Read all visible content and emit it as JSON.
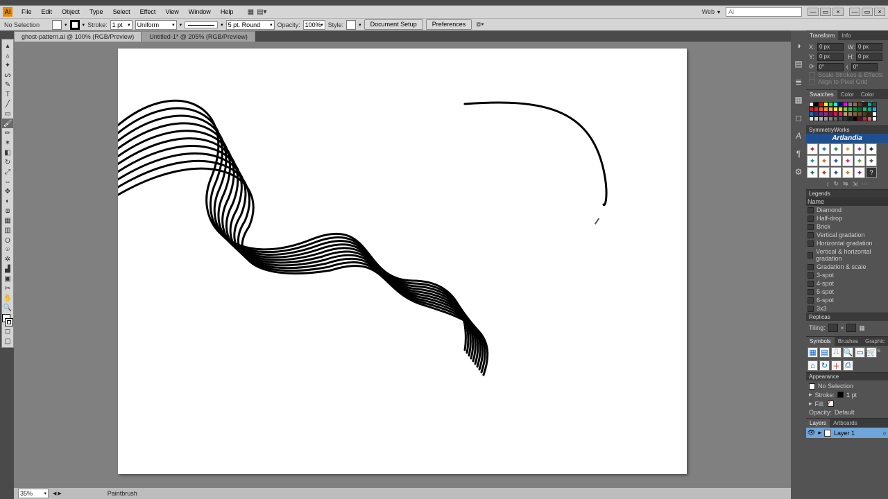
{
  "app": {
    "badge": "Ai"
  },
  "menu": [
    "File",
    "Edit",
    "Object",
    "Type",
    "Select",
    "Effect",
    "View",
    "Window",
    "Help"
  ],
  "workspace_label": "Web",
  "window_buttons": [
    "—",
    "▭",
    "×",
    "—",
    "▭",
    "×"
  ],
  "control": {
    "selection": "No Selection",
    "stroke_label": "Stroke:",
    "stroke_weight": "1 pt",
    "profile": "Uniform",
    "brush_label": "5 pt. Round",
    "opacity_label": "Opacity:",
    "opacity_value": "100%",
    "style_label": "Style:",
    "doc_setup": "Document Setup",
    "prefs": "Preferences"
  },
  "tabs": [
    {
      "label": "ghost-pattern.ai @ 100% (RGB/Preview)",
      "active": false
    },
    {
      "label": "Untitled-1* @ 205% (RGB/Preview)",
      "active": true
    }
  ],
  "status": {
    "zoom": "35%",
    "tool": "Paintbrush"
  },
  "panels": {
    "transform": {
      "tabs": [
        "Transform",
        "Info"
      ],
      "x": "0 px",
      "y": "0 px",
      "w": "0 px",
      "h": "0 px",
      "angle": "0°",
      "shear": "0°",
      "scale_chk": "Scale Strokes & Effects",
      "align_chk": "Align to Pixel Grid"
    },
    "swatches": {
      "tabs": [
        "Swatches",
        "Color",
        "Color Guide"
      ]
    },
    "swatch_colors": [
      "#ffffff",
      "#000000",
      "#ff0000",
      "#ffff00",
      "#00ff00",
      "#00ffff",
      "#0000ff",
      "#ff00ff",
      "#808080",
      "#9d6b3a",
      "#5b3b17",
      "#2e1a07",
      "#00a79d",
      "#006837",
      "#c1272d",
      "#ed1c24",
      "#f15a24",
      "#f7931e",
      "#fbb03b",
      "#fcee21",
      "#d9e021",
      "#8cc63f",
      "#39b54a",
      "#009245",
      "#006837",
      "#22b573",
      "#00a99d",
      "#29abe2",
      "#0071bc",
      "#2e3192",
      "#662d91",
      "#93278f",
      "#9e005d",
      "#d4145a",
      "#ed1e79",
      "#c69c6d",
      "#a67c52",
      "#8c6239",
      "#754c24",
      "#603813",
      "#42210b",
      "#ffffff",
      "#e6e6e6",
      "#cccccc",
      "#b3b3b3",
      "#999999",
      "#808080",
      "#666666",
      "#4d4d4d",
      "#333333",
      "#1a1a1a",
      "#000000",
      "#7a0026",
      "#a3393b",
      "#cc6666",
      "#ffffff"
    ],
    "symmetry_label": "SymmetryWorks",
    "artlandia": "Artlandia",
    "tile_fg": [
      "#b02727",
      "#1f6fb5",
      "#118a3c",
      "#caa918",
      "#8a2fa3",
      "#222222",
      "#1c8f8f",
      "#d06a1a",
      "#2e4fa0",
      "#c32f72",
      "#5b9e2d",
      "#555555",
      "#0a7d3a",
      "#b52f1c",
      "#2746a8",
      "#c7821a",
      "#7a2d8f",
      "#ffffff"
    ],
    "legends": {
      "title": "Legends",
      "header": "Name",
      "items": [
        "Diamond",
        "Half-drop",
        "Brick",
        "Vertical gradation",
        "Horizontal gradation",
        "Vertical & horizontal gradation",
        "Gradation & scale",
        "3-spot",
        "4-spot",
        "5-spot",
        "6-spot",
        "3x3"
      ]
    },
    "replicas": {
      "title": "Replicas",
      "tiling": "Tiling:"
    },
    "symbols": {
      "tabs": [
        "Symbols",
        "Brushes",
        "Graphic Styles"
      ]
    },
    "appearance": {
      "title": "Appearance",
      "no_sel": "No Selection",
      "stroke": "Stroke:",
      "stroke_val": "1 pt",
      "fill": "Fill:",
      "opacity": "Opacity:",
      "opacity_val": "Default"
    },
    "layers": {
      "tabs": [
        "Layers",
        "Artboards"
      ],
      "layer1": "Layer 1"
    }
  }
}
